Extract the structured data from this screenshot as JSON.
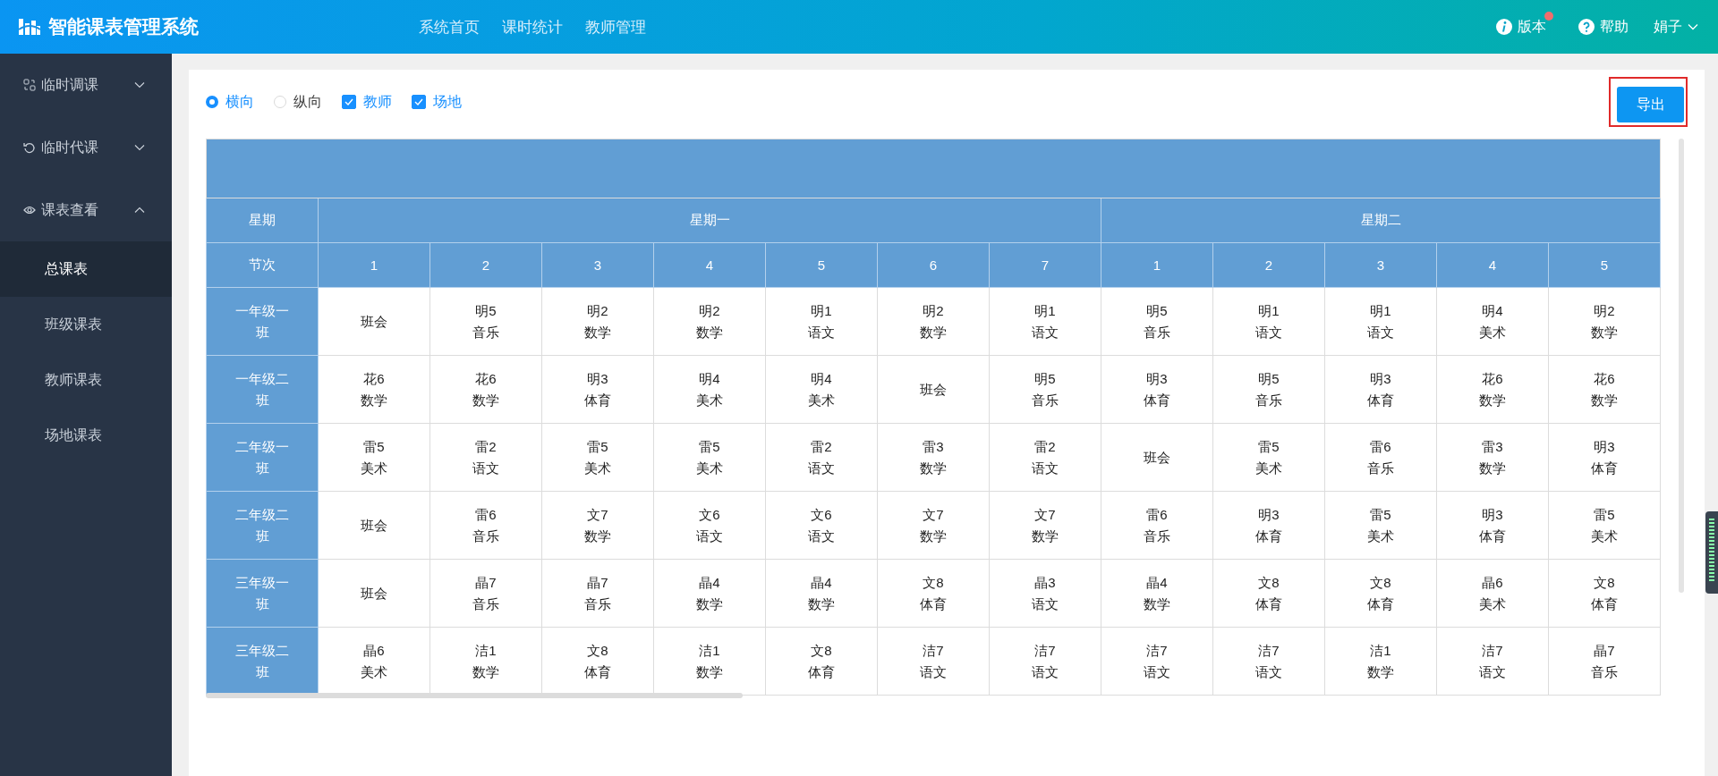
{
  "header": {
    "title": "智能课表管理系统",
    "nav": [
      "系统首页",
      "课时统计",
      "教师管理"
    ],
    "version": {
      "label": "版本",
      "notification": true
    },
    "help": "帮助",
    "user": "娟子"
  },
  "sidebar": {
    "items": [
      {
        "label": "临时调课",
        "kind": "swap",
        "expanded": false
      },
      {
        "label": "临时代课",
        "kind": "refresh",
        "expanded": false
      },
      {
        "label": "课表查看",
        "kind": "eye",
        "expanded": true,
        "children": [
          {
            "label": "总课表",
            "selected": true
          },
          {
            "label": "班级课表",
            "selected": false
          },
          {
            "label": "教师课表",
            "selected": false
          },
          {
            "label": "场地课表",
            "selected": false
          }
        ]
      }
    ]
  },
  "options": {
    "radios": [
      {
        "label": "横向",
        "selected": true
      },
      {
        "label": "纵向",
        "selected": false
      }
    ],
    "checkboxes": [
      {
        "label": "教师",
        "checked": true
      },
      {
        "label": "场地",
        "checked": true
      }
    ]
  },
  "export_button": {
    "label": "导出",
    "highlighted": true
  },
  "table": {
    "day_label": "星期",
    "period_label": "节次",
    "days": [
      {
        "name": "星期一",
        "periods": [
          "1",
          "2",
          "3",
          "4",
          "5",
          "6",
          "7"
        ]
      },
      {
        "name": "星期二",
        "periods": [
          "1",
          "2",
          "3",
          "4",
          "5"
        ]
      }
    ],
    "rows": [
      {
        "class": "一年级一班",
        "cells": [
          "班会",
          "明5\n音乐",
          "明2\n数学",
          "明2\n数学",
          "明1\n语文",
          "明2\n数学",
          "明1\n语文",
          "明5\n音乐",
          "明1\n语文",
          "明1\n语文",
          "明4\n美术",
          "明2\n数学"
        ]
      },
      {
        "class": "一年级二班",
        "cells": [
          "花6\n数学",
          "花6\n数学",
          "明3\n体育",
          "明4\n美术",
          "明4\n美术",
          "班会",
          "明5\n音乐",
          "明3\n体育",
          "明5\n音乐",
          "明3\n体育",
          "花6\n数学",
          "花6\n数学"
        ]
      },
      {
        "class": "二年级一班",
        "cells": [
          "雷5\n美术",
          "雷2\n语文",
          "雷5\n美术",
          "雷5\n美术",
          "雷2\n语文",
          "雷3\n数学",
          "雷2\n语文",
          "班会",
          "雷5\n美术",
          "雷6\n音乐",
          "雷3\n数学",
          "明3\n体育"
        ]
      },
      {
        "class": "二年级二班",
        "cells": [
          "班会",
          "雷6\n音乐",
          "文7\n数学",
          "文6\n语文",
          "文6\n语文",
          "文7\n数学",
          "文7\n数学",
          "雷6\n音乐",
          "明3\n体育",
          "雷5\n美术",
          "明3\n体育",
          "雷5\n美术"
        ]
      },
      {
        "class": "三年级一班",
        "cells": [
          "班会",
          "晶7\n音乐",
          "晶7\n音乐",
          "晶4\n数学",
          "晶4\n数学",
          "文8\n体育",
          "晶3\n语文",
          "晶4\n数学",
          "文8\n体育",
          "文8\n体育",
          "晶6\n美术",
          "文8\n体育"
        ]
      },
      {
        "class": "三年级二班",
        "cells": [
          "晶6\n美术",
          "洁1\n数学",
          "文8\n体育",
          "洁1\n数学",
          "文8\n体育",
          "洁7\n语文",
          "洁7\n语文",
          "洁7\n语文",
          "洁7\n语文",
          "洁1\n数学",
          "洁7\n语文",
          "晶7\n音乐"
        ]
      }
    ]
  }
}
